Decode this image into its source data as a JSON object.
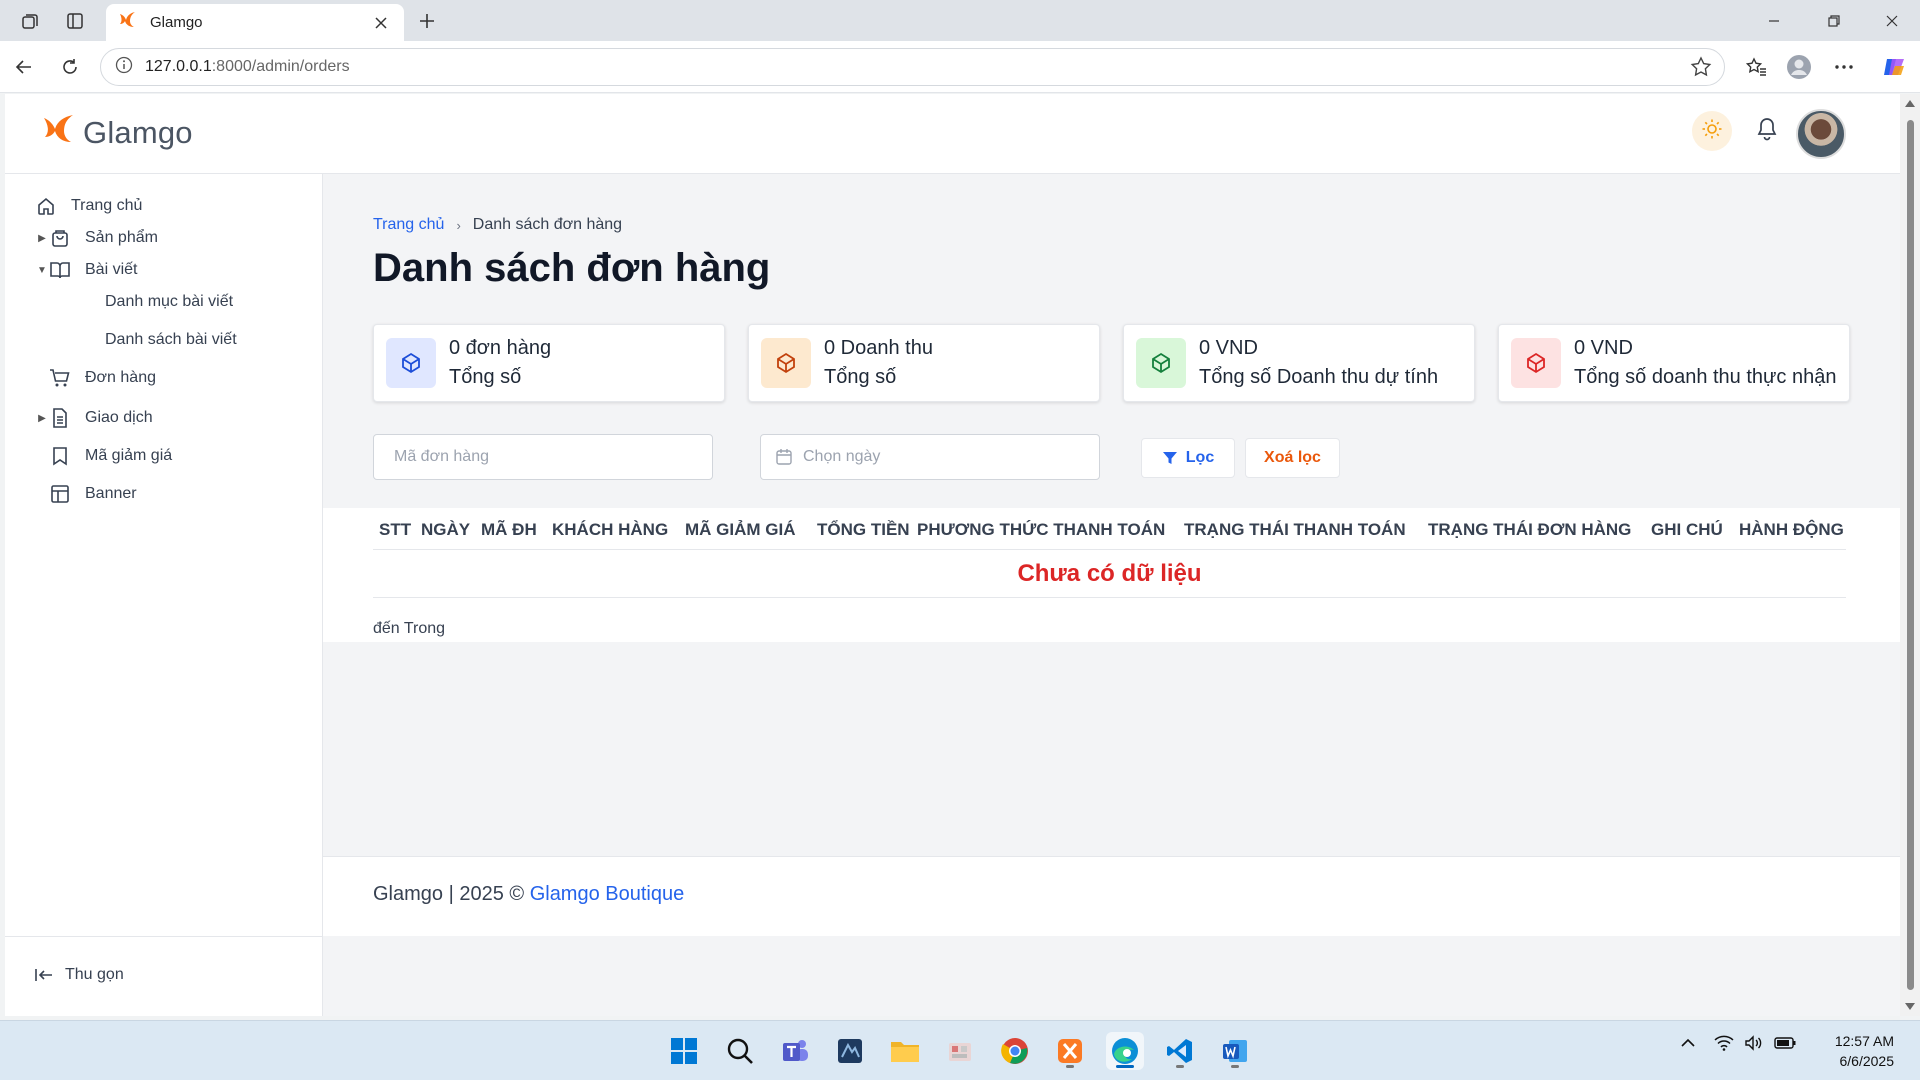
{
  "browser": {
    "tab_title": "Glamgo",
    "url_host": "127.0.0.1",
    "url_path": ":8000/admin/orders"
  },
  "app": {
    "logo_text": "Glamgo"
  },
  "sidebar": {
    "items": [
      {
        "label": "Trang chủ"
      },
      {
        "label": "Sản phẩm"
      },
      {
        "label": "Bài viết"
      },
      {
        "label": "Danh mục bài viết"
      },
      {
        "label": "Danh sách bài viết"
      },
      {
        "label": "Đơn hàng"
      },
      {
        "label": "Giao dịch"
      },
      {
        "label": "Mã giảm giá"
      },
      {
        "label": "Banner"
      }
    ],
    "collapse_label": "Thu gọn"
  },
  "breadcrumb": {
    "home": "Trang chủ",
    "current": "Danh sách đơn hàng"
  },
  "page_title": "Danh sách đơn hàng",
  "stats": [
    {
      "line1": "0 đơn hàng",
      "line2": "Tổng số",
      "color": "#1d4ed8",
      "bg": "#e0e7ff"
    },
    {
      "line1": "0 Doanh thu",
      "line2": "Tổng số",
      "color": "#c2410c",
      "bg": "#fde9cf"
    },
    {
      "line1": "0 VND",
      "line2": "Tổng số Doanh thu dự tính",
      "color": "#15803d",
      "bg": "#d9f7d9"
    },
    {
      "line1": "0 VND",
      "line2": "Tổng số doanh thu thực nhận",
      "color": "#dc2626",
      "bg": "#fde2e2"
    }
  ],
  "filters": {
    "order_code_placeholder": "Mã đơn hàng",
    "date_placeholder": "Chọn ngày",
    "filter_label": "Lọc",
    "clear_label": "Xoá lọc"
  },
  "table": {
    "headers": [
      "STT",
      "NGÀY",
      "MÃ ĐH",
      "KHÁCH HÀNG",
      "MÃ GIẢM GIÁ",
      "TỔNG TIỀN",
      "PHƯƠNG THỨC THANH TOÁN",
      "TRẠNG THÁI THANH TOÁN",
      "TRẠNG THÁI ĐƠN HÀNG",
      "GHI CHÚ",
      "HÀNH ĐỘNG"
    ],
    "empty_text": "Chưa có dữ liệu",
    "pagination_text": "đến Trong"
  },
  "footer": {
    "text": "Glamgo | 2025 © ",
    "link": "Glamgo Boutique"
  },
  "taskbar": {
    "time": "12:57 AM",
    "date": "6/6/2025"
  },
  "colors": {
    "primary": "#2563eb",
    "danger": "#dc2626",
    "accent": "#ea580c"
  }
}
